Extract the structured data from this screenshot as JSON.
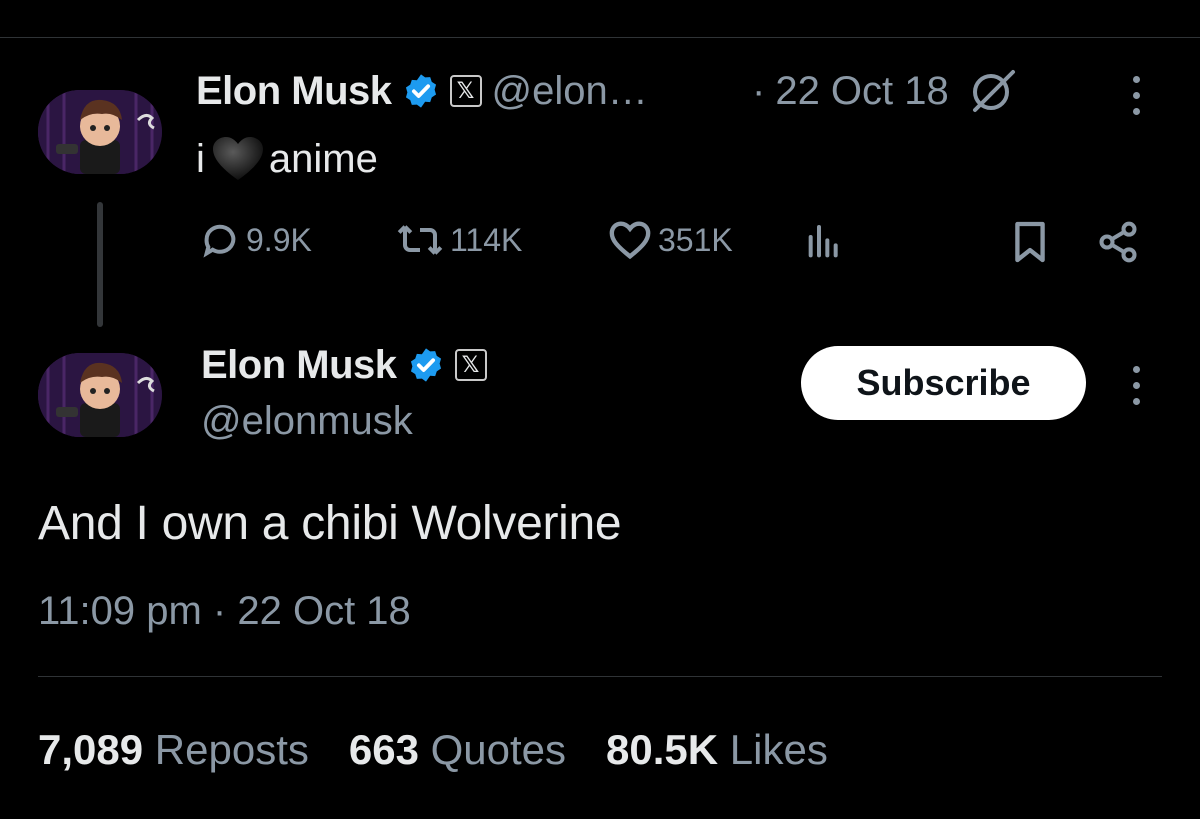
{
  "parent_tweet": {
    "author_name": "Elon Musk",
    "handle": "@elon…",
    "date_separator": "·",
    "date": "22 Oct 18",
    "text_prefix": "i",
    "text_suffix": "anime",
    "actions": {
      "replies": "9.9K",
      "reposts": "114K",
      "likes": "351K"
    }
  },
  "main_tweet": {
    "author_name": "Elon Musk",
    "handle": "@elonmusk",
    "subscribe_label": "Subscribe",
    "text": "And I own a chibi Wolverine",
    "timestamp": "11:09 pm · 22 Oct 18",
    "stats": {
      "reposts_count": "7,089",
      "reposts_label": "Reposts",
      "quotes_count": "663",
      "quotes_label": "Quotes",
      "likes_count": "80.5K",
      "likes_label": "Likes"
    }
  },
  "icons": {
    "verified": "verified-badge-icon",
    "x_affiliation": "x-logo-icon",
    "grok": "slashed-circle-icon",
    "reply": "reply-bubble-icon",
    "repost": "repost-icon",
    "like": "heart-icon",
    "views": "views-bars-icon",
    "bookmark": "bookmark-icon",
    "share": "share-icon",
    "more": "more-vertical-icon"
  },
  "colors": {
    "background": "#000000",
    "text": "#e7e9ea",
    "muted": "#8b98a5",
    "verified_blue": "#1d9bf0",
    "subscribe_bg": "#ffffff"
  }
}
